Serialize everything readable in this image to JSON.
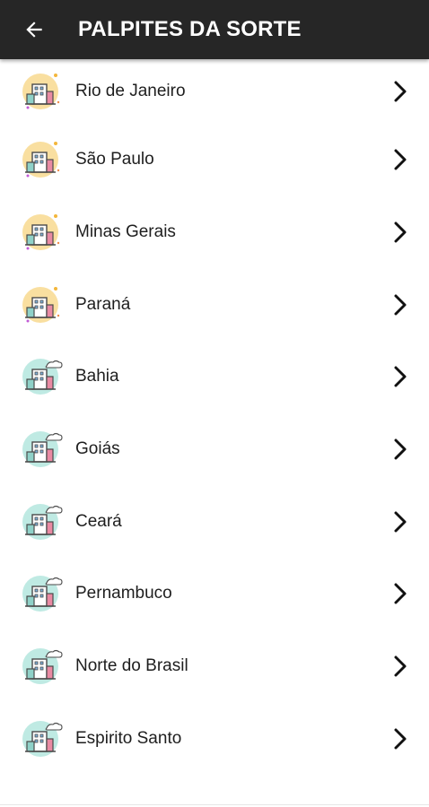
{
  "appbar": {
    "title": "PALPITES DA SORTE",
    "back_icon": "arrow-left-icon"
  },
  "colors": {
    "appbar_bg": "#262626",
    "icon_sun_bg": "#f9dfa0",
    "icon_cloud_bg": "#bfeae3"
  },
  "items": [
    {
      "label": "Rio de Janeiro",
      "icon": "city-sun-icon"
    },
    {
      "label": "São Paulo",
      "icon": "city-sun-icon"
    },
    {
      "label": "Minas Gerais",
      "icon": "city-sun-icon"
    },
    {
      "label": "Paraná",
      "icon": "city-sun-icon"
    },
    {
      "label": "Bahia",
      "icon": "city-cloud-icon"
    },
    {
      "label": "Goiás",
      "icon": "city-cloud-icon"
    },
    {
      "label": "Ceará",
      "icon": "city-cloud-icon"
    },
    {
      "label": "Pernambuco",
      "icon": "city-cloud-icon"
    },
    {
      "label": "Norte do Brasil",
      "icon": "city-cloud-icon"
    },
    {
      "label": "Espirito Santo",
      "icon": "city-cloud-icon"
    }
  ]
}
